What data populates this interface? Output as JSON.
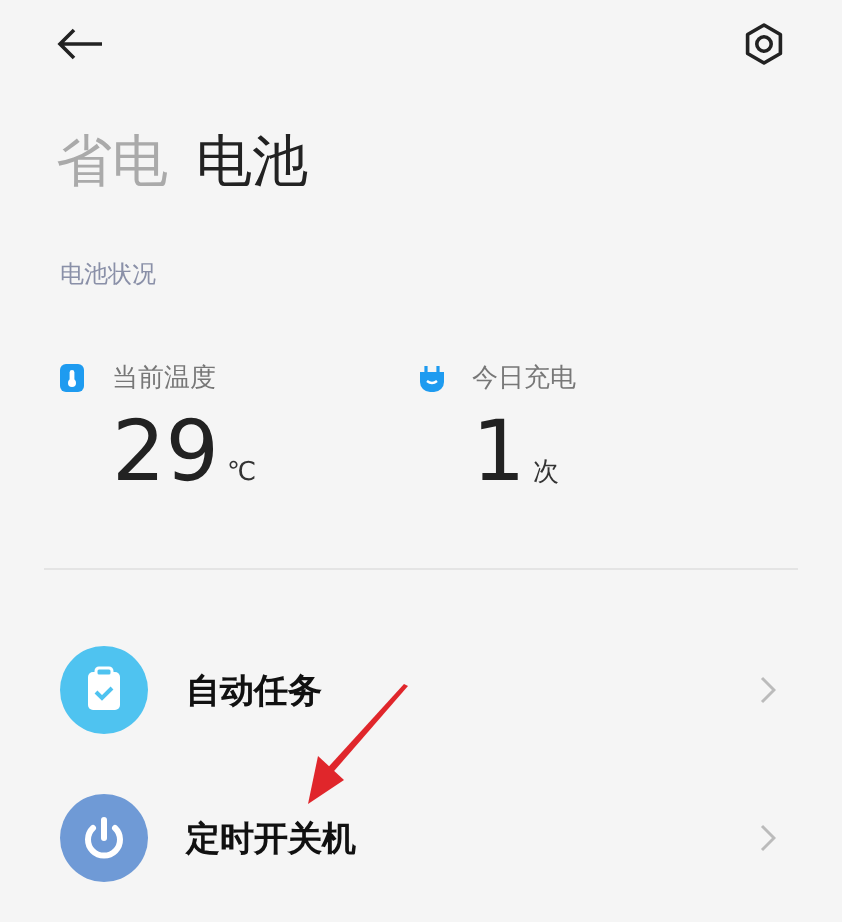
{
  "tabs": [
    {
      "label": "省电",
      "selected": false
    },
    {
      "label": "电池",
      "selected": true
    }
  ],
  "section_title": "电池状况",
  "stats": [
    {
      "kind": "temperature",
      "label": "当前温度",
      "value": "29",
      "unit": "℃"
    },
    {
      "kind": "charge",
      "label": "今日充电",
      "value": "1",
      "unit": "次"
    }
  ],
  "items": [
    {
      "kind": "tasks",
      "label": "自动任务"
    },
    {
      "kind": "power",
      "label": "定时开关机"
    }
  ]
}
